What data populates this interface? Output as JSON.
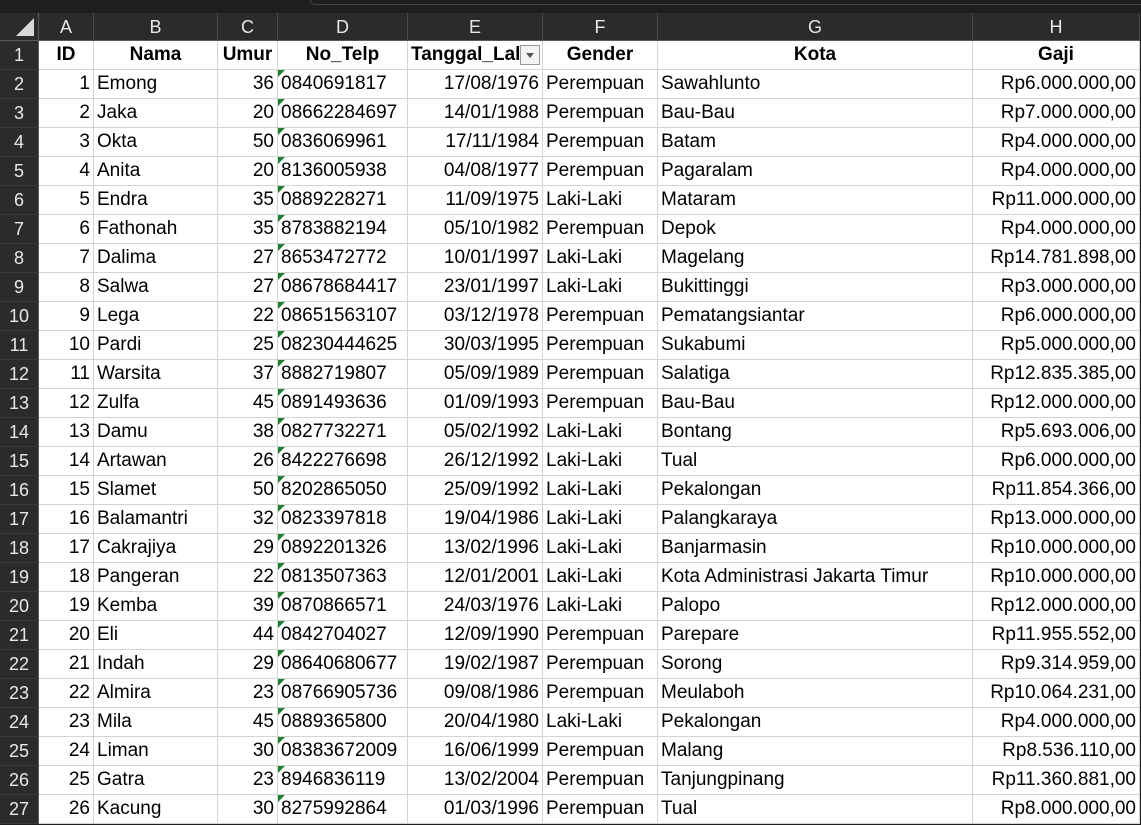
{
  "columns": [
    "A",
    "B",
    "C",
    "D",
    "E",
    "F",
    "G",
    "H"
  ],
  "headers": [
    "ID",
    "Nama",
    "Umur",
    "No_Telp",
    "Tanggal_Lal",
    "Gender",
    "Kota",
    "Gaji"
  ],
  "rows": [
    [
      "1",
      "Emong",
      "36",
      "0840691817",
      "17/08/1976",
      "Perempuan",
      "Sawahlunto",
      "Rp6.000.000,00"
    ],
    [
      "2",
      "Jaka",
      "20",
      "08662284697",
      "14/01/1988",
      "Perempuan",
      "Bau-Bau",
      "Rp7.000.000,00"
    ],
    [
      "3",
      "Okta",
      "50",
      "0836069961",
      "17/11/1984",
      "Perempuan",
      "Batam",
      "Rp4.000.000,00"
    ],
    [
      "4",
      "Anita",
      "20",
      "8136005938",
      "04/08/1977",
      "Perempuan",
      "Pagaralam",
      "Rp4.000.000,00"
    ],
    [
      "5",
      "Endra",
      "35",
      "0889228271",
      "11/09/1975",
      "Laki-Laki",
      "Mataram",
      "Rp11.000.000,00"
    ],
    [
      "6",
      "Fathonah",
      "35",
      "8783882194",
      "05/10/1982",
      "Perempuan",
      "Depok",
      "Rp4.000.000,00"
    ],
    [
      "7",
      "Dalima",
      "27",
      "8653472772",
      "10/01/1997",
      "Laki-Laki",
      "Magelang",
      "Rp14.781.898,00"
    ],
    [
      "8",
      "Salwa",
      "27",
      "08678684417",
      "23/01/1997",
      "Laki-Laki",
      "Bukittinggi",
      "Rp3.000.000,00"
    ],
    [
      "9",
      "Lega",
      "22",
      "08651563107",
      "03/12/1978",
      "Perempuan",
      "Pematangsiantar",
      "Rp6.000.000,00"
    ],
    [
      "10",
      "Pardi",
      "25",
      "08230444625",
      "30/03/1995",
      "Perempuan",
      "Sukabumi",
      "Rp5.000.000,00"
    ],
    [
      "11",
      "Warsita",
      "37",
      "8882719807",
      "05/09/1989",
      "Perempuan",
      "Salatiga",
      "Rp12.835.385,00"
    ],
    [
      "12",
      "Zulfa",
      "45",
      "0891493636",
      "01/09/1993",
      "Perempuan",
      "Bau-Bau",
      "Rp12.000.000,00"
    ],
    [
      "13",
      "Damu",
      "38",
      "0827732271",
      "05/02/1992",
      "Laki-Laki",
      "Bontang",
      "Rp5.693.006,00"
    ],
    [
      "14",
      "Artawan",
      "26",
      "8422276698",
      "26/12/1992",
      "Laki-Laki",
      "Tual",
      "Rp6.000.000,00"
    ],
    [
      "15",
      "Slamet",
      "50",
      "8202865050",
      "25/09/1992",
      "Laki-Laki",
      "Pekalongan",
      "Rp11.854.366,00"
    ],
    [
      "16",
      "Balamantri",
      "32",
      "0823397818",
      "19/04/1986",
      "Laki-Laki",
      "Palangkaraya",
      "Rp13.000.000,00"
    ],
    [
      "17",
      "Cakrajiya",
      "29",
      "0892201326",
      "13/02/1996",
      "Laki-Laki",
      "Banjarmasin",
      "Rp10.000.000,00"
    ],
    [
      "18",
      "Pangeran",
      "22",
      "0813507363",
      "12/01/2001",
      "Laki-Laki",
      "Kota Administrasi Jakarta Timur",
      "Rp10.000.000,00"
    ],
    [
      "19",
      "Kemba",
      "39",
      "0870866571",
      "24/03/1976",
      "Laki-Laki",
      "Palopo",
      "Rp12.000.000,00"
    ],
    [
      "20",
      "Eli",
      "44",
      "0842704027",
      "12/09/1990",
      "Perempuan",
      "Parepare",
      "Rp11.955.552,00"
    ],
    [
      "21",
      "Indah",
      "29",
      "08640680677",
      "19/02/1987",
      "Perempuan",
      "Sorong",
      "Rp9.314.959,00"
    ],
    [
      "22",
      "Almira",
      "23",
      "08766905736",
      "09/08/1986",
      "Perempuan",
      "Meulaboh",
      "Rp10.064.231,00"
    ],
    [
      "23",
      "Mila",
      "45",
      "0889365800",
      "20/04/1980",
      "Laki-Laki",
      "Pekalongan",
      "Rp4.000.000,00"
    ],
    [
      "24",
      "Liman",
      "30",
      "08383672009",
      "16/06/1999",
      "Perempuan",
      "Malang",
      "Rp8.536.110,00"
    ],
    [
      "25",
      "Gatra",
      "23",
      "8946836119",
      "13/02/2004",
      "Perempuan",
      "Tanjungpinang",
      "Rp11.360.881,00"
    ],
    [
      "26",
      "Kacung",
      "30",
      "8275992864",
      "01/03/1996",
      "Perempuan",
      "Tual",
      "Rp8.000.000,00"
    ]
  ],
  "row_numbers": [
    "1",
    "2",
    "3",
    "4",
    "5",
    "6",
    "7",
    "8",
    "9",
    "10",
    "11",
    "12",
    "13",
    "14",
    "15",
    "16",
    "17",
    "18",
    "19",
    "20",
    "21",
    "22",
    "23",
    "24",
    "25",
    "26",
    "27"
  ],
  "colors": {
    "sheet_bg": "#ffffff",
    "header_bg": "#2b2b2b",
    "note_indicator": "#1e7e34"
  }
}
